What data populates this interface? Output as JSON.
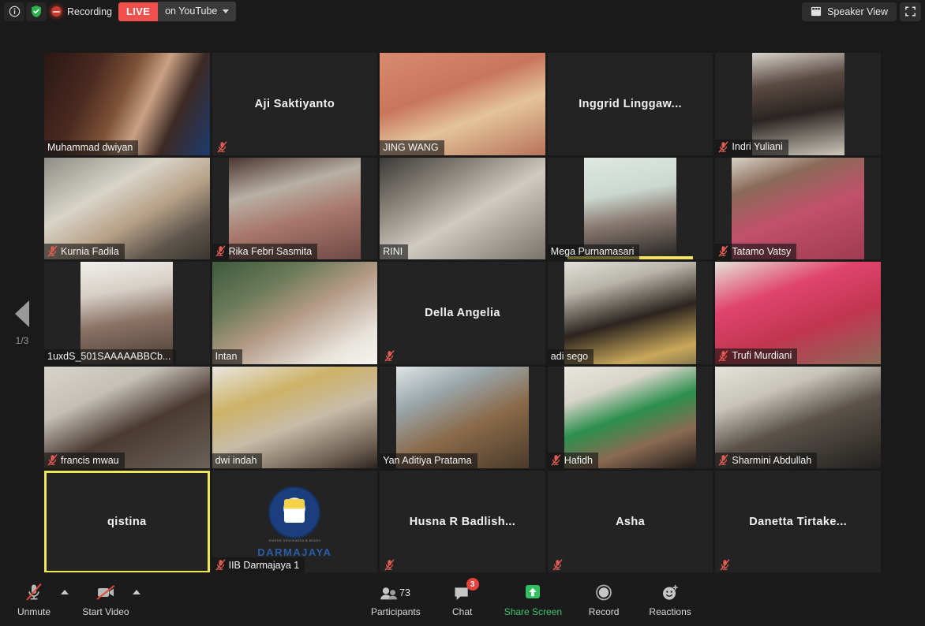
{
  "topbar": {
    "info_icon": "info-circle-icon",
    "shield_icon": "shield-check-icon",
    "recording_label": "Recording",
    "live_label": "LIVE",
    "platform_label": "on YouTube",
    "view_label": "Speaker View",
    "view_icon": "grid-view-icon",
    "fullscreen_icon": "fullscreen-icon"
  },
  "gallery": {
    "page_indicator": "1/3",
    "prev_page_icon": "chevron-left-icon",
    "participants": [
      {
        "name": "Muhammad dwiyan",
        "video": true,
        "muted": false,
        "label_pos": "bar",
        "bg": "bg1",
        "inset": "full",
        "speaking": false
      },
      {
        "name": "Aji Saktiyanto",
        "video": false,
        "muted": true,
        "label_pos": "center",
        "bg": "bg-dark",
        "inset": "full",
        "speaking": false
      },
      {
        "name": "JING WANG",
        "video": true,
        "muted": false,
        "label_pos": "bar",
        "bg": "bg-jing",
        "inset": "full",
        "speaking": false
      },
      {
        "name": "Inggrid  Linggaw...",
        "video": false,
        "muted": false,
        "label_pos": "center",
        "bg": "bg-dark",
        "inset": "full",
        "speaking": false
      },
      {
        "name": "Indri Yuliani",
        "video": true,
        "muted": true,
        "label_pos": "bar",
        "bg": "bg-indri",
        "inset": "narrow",
        "speaking": false
      },
      {
        "name": "Kurnia Fadila",
        "video": true,
        "muted": true,
        "label_pos": "bar",
        "bg": "bg-kurnia",
        "inset": "full",
        "speaking": false
      },
      {
        "name": "Rika Febri Sasmita",
        "video": true,
        "muted": true,
        "label_pos": "bar",
        "bg": "bg-rika",
        "inset": "mid",
        "speaking": false
      },
      {
        "name": "RINI",
        "video": true,
        "muted": false,
        "label_pos": "bar",
        "bg": "bg-rini",
        "inset": "full",
        "speaking": false
      },
      {
        "name": "Mega Purnamasari",
        "video": true,
        "muted": false,
        "label_pos": "bar",
        "bg": "bg-mega",
        "inset": "narrow",
        "speaking": true
      },
      {
        "name": "Tatamo Vatsy",
        "video": true,
        "muted": true,
        "label_pos": "bar",
        "bg": "bg-tatamo",
        "inset": "mid",
        "speaking": false
      },
      {
        "name": "1uxdS_501SAAAAABBCb...",
        "video": true,
        "muted": false,
        "label_pos": "bar",
        "bg": "bg-1uxds",
        "inset": "narrow",
        "speaking": false
      },
      {
        "name": "Intan",
        "video": true,
        "muted": false,
        "label_pos": "bar",
        "bg": "bg-intan",
        "inset": "full",
        "speaking": false
      },
      {
        "name": "Della Angelia",
        "video": false,
        "muted": true,
        "label_pos": "center",
        "bg": "bg-dark",
        "inset": "full",
        "speaking": false
      },
      {
        "name": "adi sego",
        "video": true,
        "muted": false,
        "label_pos": "bar",
        "bg": "bg-adi",
        "inset": "mid",
        "speaking": false
      },
      {
        "name": "Trufi Murdiani",
        "video": true,
        "muted": true,
        "label_pos": "bar",
        "bg": "bg-trufi",
        "inset": "full",
        "speaking": false
      },
      {
        "name": "francis mwau",
        "video": true,
        "muted": true,
        "label_pos": "bar",
        "bg": "bg-francis",
        "inset": "full",
        "speaking": false
      },
      {
        "name": "dwi indah",
        "video": true,
        "muted": false,
        "label_pos": "bar",
        "bg": "bg-dwi",
        "inset": "full",
        "speaking": false
      },
      {
        "name": "Yan Aditiya Pratama",
        "video": true,
        "muted": false,
        "label_pos": "bar",
        "bg": "bg-yan",
        "inset": "mid",
        "speaking": false
      },
      {
        "name": "Hafidh",
        "video": true,
        "muted": true,
        "label_pos": "bar",
        "bg": "bg-hafidh",
        "inset": "mid",
        "speaking": false
      },
      {
        "name": "Sharmini Abdullah",
        "video": true,
        "muted": true,
        "label_pos": "bar",
        "bg": "bg-sharmini",
        "inset": "full",
        "speaking": false
      },
      {
        "name": "qistina",
        "video": false,
        "muted": false,
        "label_pos": "center",
        "bg": "bg-dark",
        "inset": "full",
        "speaking": false,
        "highlighted": true
      },
      {
        "name": "IIB Darmajaya 1",
        "video": false,
        "muted": true,
        "label_pos": "bar",
        "bg": "bg-dark",
        "inset": "full",
        "speaking": false,
        "logo": "darmajaya-logo",
        "logo_word": "DARMAJAYA",
        "logo_sub": "Institut Informatika & Bisnis"
      },
      {
        "name": "Husna R Badlish...",
        "video": false,
        "muted": true,
        "label_pos": "center",
        "bg": "bg-dark",
        "inset": "full",
        "speaking": false
      },
      {
        "name": "Asha",
        "video": false,
        "muted": true,
        "label_pos": "center",
        "bg": "bg-dark",
        "inset": "full",
        "speaking": false
      },
      {
        "name": "Danetta  Tirtake...",
        "video": false,
        "muted": true,
        "label_pos": "center",
        "bg": "bg-dark",
        "inset": "full",
        "speaking": false
      }
    ]
  },
  "toolbar": {
    "unmute_label": "Unmute",
    "unmute_icon": "mic-off-icon",
    "start_video_label": "Start Video",
    "start_video_icon": "video-off-icon",
    "participants_label": "Participants",
    "participants_icon": "people-icon",
    "participants_count": "73",
    "chat_label": "Chat",
    "chat_icon": "chat-bubble-icon",
    "chat_badge": "3",
    "share_screen_label": "Share Screen",
    "share_screen_icon": "share-screen-icon",
    "record_label": "Record",
    "record_icon": "record-circle-icon",
    "reactions_label": "Reactions",
    "reactions_icon": "reactions-smiley-icon"
  },
  "colors": {
    "live_red": "#f0514c",
    "share_green": "#3ec46d",
    "badge_red": "#e8413c",
    "active_speaker": "#ece658",
    "mute_red": "#e05c52"
  }
}
